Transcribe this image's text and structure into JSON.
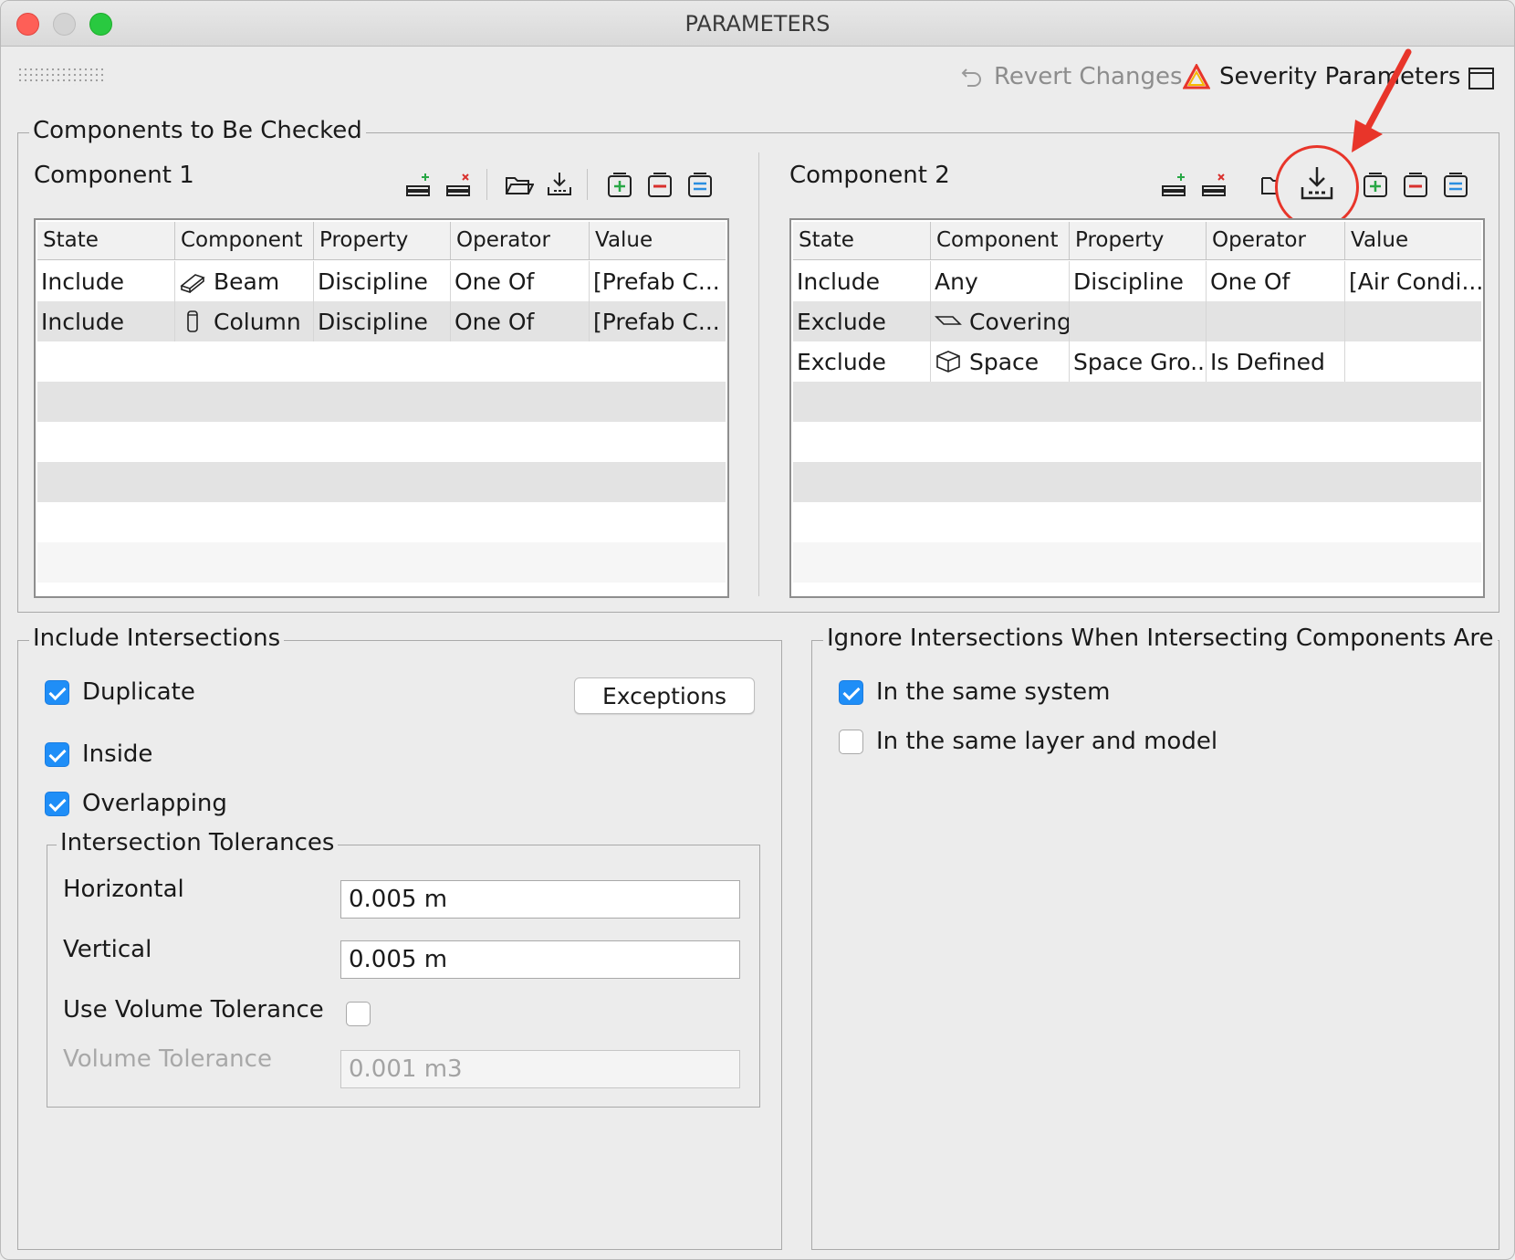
{
  "window": {
    "title": "PARAMETERS"
  },
  "toolbar": {
    "revert_label": "Revert Changes",
    "severity_label": "Severity Parameters"
  },
  "components_group": {
    "title": "Components to Be Checked",
    "component1": {
      "label": "Component 1",
      "columns": [
        "State",
        "Component",
        "Property",
        "Operator",
        "Value"
      ],
      "rows": [
        {
          "state": "Include",
          "component": "Beam",
          "icon": "beam-icon",
          "property": "Discipline",
          "operator": "One Of",
          "value": "[Prefab C..."
        },
        {
          "state": "Include",
          "component": "Column",
          "icon": "column-icon",
          "property": "Discipline",
          "operator": "One Of",
          "value": "[Prefab C..."
        }
      ]
    },
    "component2": {
      "label": "Component 2",
      "columns": [
        "State",
        "Component",
        "Property",
        "Operator",
        "Value"
      ],
      "rows": [
        {
          "state": "Include",
          "component": "Any",
          "icon": "",
          "property": "Discipline",
          "operator": "One Of",
          "value": "[Air Condi..."
        },
        {
          "state": "Exclude",
          "component": "Covering",
          "icon": "covering-icon",
          "property": "",
          "operator": "",
          "value": ""
        },
        {
          "state": "Exclude",
          "component": "Space",
          "icon": "space-icon",
          "property": "Space Gro...",
          "operator": "Is Defined",
          "value": ""
        }
      ]
    }
  },
  "include_group": {
    "title": "Include Intersections",
    "duplicate": {
      "label": "Duplicate",
      "checked": true
    },
    "inside": {
      "label": "Inside",
      "checked": true
    },
    "overlapping": {
      "label": "Overlapping",
      "checked": true
    },
    "exceptions_label": "Exceptions",
    "tolerances": {
      "title": "Intersection Tolerances",
      "horizontal_label": "Horizontal",
      "horizontal_value": "0.005 m",
      "vertical_label": "Vertical",
      "vertical_value": "0.005 m",
      "use_volume_label": "Use Volume Tolerance",
      "use_volume_checked": false,
      "volume_label": "Volume Tolerance",
      "volume_value": "0.001 m3"
    }
  },
  "ignore_group": {
    "title": "Ignore Intersections When Intersecting Components Are",
    "same_system": {
      "label": "In the same system",
      "checked": true
    },
    "same_layer": {
      "label": "In the same layer and model",
      "checked": false
    }
  },
  "colors": {
    "checkbox_on": "#1f8ef7",
    "annotation": "#e8352a",
    "add_green": "#28a745",
    "remove_red": "#d9302c",
    "equals_blue": "#2a8ee0"
  }
}
